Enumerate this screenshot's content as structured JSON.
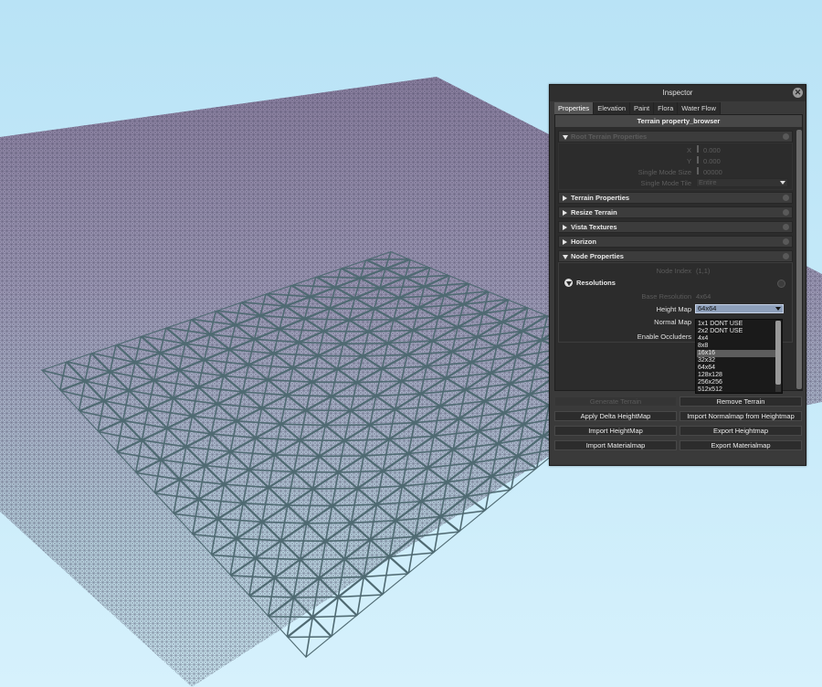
{
  "inspector": {
    "title": "Inspector",
    "close_glyph": "✕",
    "tabs": [
      "Properties",
      "Elevation",
      "Paint",
      "Flora",
      "Water Flow"
    ],
    "pane_title": "Terrain property_browser",
    "faded_section": {
      "label": "Root Terrain Properties",
      "rows": [
        {
          "label": "X",
          "value": "0.000"
        },
        {
          "label": "Y",
          "value": "0.000"
        },
        {
          "label": "Single Mode Size",
          "value": "00000"
        },
        {
          "label": "Single Mode Tile",
          "value": "Entire"
        }
      ]
    },
    "sections": [
      "Terrain Properties",
      "Resize Terrain",
      "Vista Textures",
      "Horizon",
      "Node Properties"
    ],
    "node_props": {
      "node_index_label": "Node Index",
      "node_index_value": "(1,1)",
      "resolutions_label": "Resolutions",
      "base_resolution_label": "Base Resolution",
      "base_resolution_value": "4x64",
      "height_map_label": "Height Map",
      "height_map_value": "64x64",
      "normal_map_label": "Normal Map",
      "enable_occluders_label": "Enable Occluders"
    },
    "dropdown_options": [
      "1x1 DONT USE",
      "2x2 DONT USE",
      "4x4",
      "8x8",
      "16x16",
      "32x32",
      "64x64",
      "128x128",
      "256x256",
      "512x512"
    ],
    "dropdown_highlight": "16x16",
    "buttons": {
      "generate": "Generate Terrain",
      "remove": "Remove Terrain",
      "apply_delta": "Apply Delta HeightMap",
      "import_normalmap": "Import Normalmap from Heightmap",
      "import_heightmap": "Import HeightMap",
      "export_heightmap": "Export Heightmap",
      "import_materialmap": "Import Materialmap",
      "export_materialmap": "Export Materialmap"
    }
  },
  "colors": {
    "sky": "#c5e9f8",
    "fine_mesh_tint": "#b7a7c7",
    "coarse_mesh": "#4f6a72",
    "panel_bg": "#3a3a3a",
    "selected_field": "#8ea0bb"
  }
}
